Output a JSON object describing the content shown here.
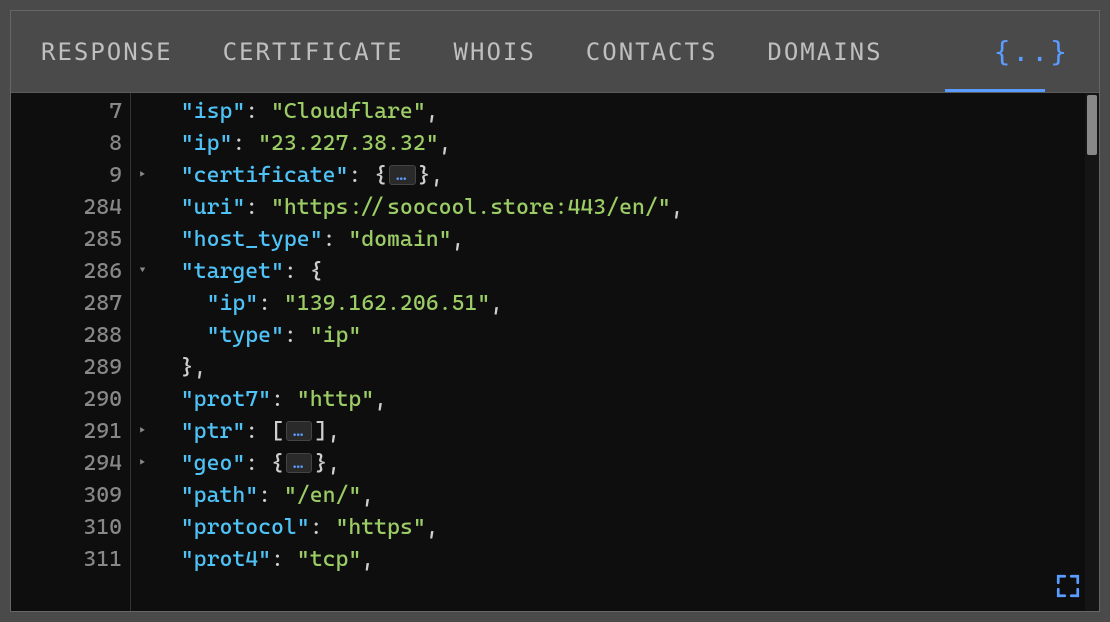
{
  "tabs": {
    "response": "RESPONSE",
    "certificate": "CERTIFICATE",
    "whois": "WHOIS",
    "contacts": "CONTACTS",
    "domains": "DOMAINS",
    "json": "{..}"
  },
  "gutter": {
    "l0": "7",
    "l1": "8",
    "l2": "9",
    "l3": "284",
    "l4": "285",
    "l5": "286",
    "l6": "287",
    "l7": "288",
    "l8": "289",
    "l9": "290",
    "l10": "291",
    "l11": "294",
    "l12": "309",
    "l13": "310",
    "l14": "311"
  },
  "code": {
    "isp_key": "\"isp\"",
    "isp_val": "\"Cloudflare\"",
    "ip_key": "\"ip\"",
    "ip_val": "\"23.227.38.32\"",
    "cert_key": "\"certificate\"",
    "uri_key": "\"uri\"",
    "uri_val": "\"https://soocool.store:443/en/\"",
    "host_type_key": "\"host_type\"",
    "host_type_val": "\"domain\"",
    "target_key": "\"target\"",
    "target_ip_key": "\"ip\"",
    "target_ip_val": "\"139.162.206.51\"",
    "target_type_key": "\"type\"",
    "target_type_val": "\"ip\"",
    "prot7_key": "\"prot7\"",
    "prot7_val": "\"http\"",
    "ptr_key": "\"ptr\"",
    "geo_key": "\"geo\"",
    "path_key": "\"path\"",
    "path_val": "\"/en/\"",
    "protocol_key": "\"protocol\"",
    "protocol_val": "\"https\"",
    "prot4_key": "\"prot4\"",
    "prot4_val": "\"tcp\"",
    "dots": "…"
  }
}
